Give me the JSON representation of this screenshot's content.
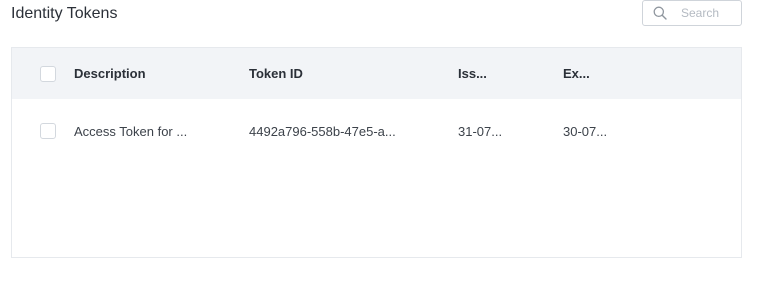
{
  "page": {
    "title": "Identity Tokens"
  },
  "search": {
    "placeholder": "Search",
    "icon": "search-icon"
  },
  "table": {
    "columns": [
      {
        "key": "description",
        "label": "Description"
      },
      {
        "key": "token_id",
        "label": "Token ID"
      },
      {
        "key": "issued",
        "label": "Iss..."
      },
      {
        "key": "expires",
        "label": "Ex..."
      }
    ],
    "rows": [
      {
        "description": "Access Token for ...",
        "token_id": "4492a796-558b-47e5-a...",
        "issued": "31-07...",
        "expires": "30-07..."
      }
    ]
  }
}
